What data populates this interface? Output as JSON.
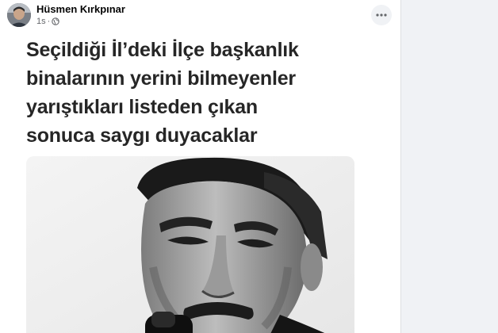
{
  "post": {
    "author": "Hüsmen Kırkpınar",
    "timestamp": "1s",
    "privacy_icon": "globe-icon",
    "more_icon": "more-horizontal-icon",
    "text_lines": [
      "Seçildiği İl’deki İlçe başkanlık",
      "binalarının yerini bilmeyenler",
      "yarıştıkları listeden çıkan",
      "sonuca saygı duyacaklar"
    ],
    "image_icon": "portrait-photo"
  },
  "colors": {
    "name": "#050505",
    "meta": "#65676b",
    "background": "#f0f2f5"
  }
}
